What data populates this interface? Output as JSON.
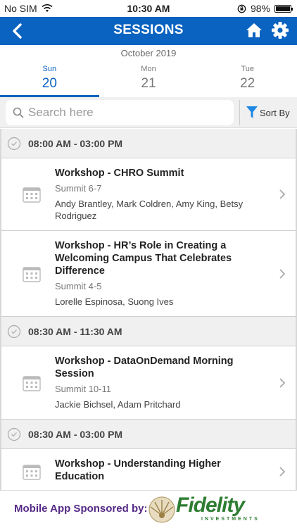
{
  "status_bar": {
    "carrier": "No SIM",
    "time": "10:30 AM",
    "battery": "98%",
    "battery_level": 0.98
  },
  "nav": {
    "title": "SESSIONS",
    "icons": [
      "back-arrow-icon",
      "home-icon",
      "gear-icon"
    ]
  },
  "calendar": {
    "month": "October 2019",
    "days": [
      {
        "name": "Sun",
        "number": "20",
        "selected": true
      },
      {
        "name": "Mon",
        "number": "21",
        "selected": false
      },
      {
        "name": "Tue",
        "number": "22",
        "selected": false
      }
    ]
  },
  "search": {
    "placeholder": "Search here",
    "value": "",
    "sort_label": "Sort By"
  },
  "groups": [
    {
      "time": "08:00 AM - 03:00 PM",
      "sessions": [
        {
          "title": "Workshop - CHRO Summit",
          "room": "Summit 6-7",
          "speakers": "Andy Brantley, Mark Coldren, Amy King, Betsy Rodriguez"
        },
        {
          "title": "Workshop - HR’s Role in Creating a Welcoming Campus That Celebrates Difference",
          "room": "Summit 4-5",
          "speakers": "Lorelle Espinosa, Suong Ives"
        }
      ]
    },
    {
      "time": "08:30 AM - 11:30 AM",
      "sessions": [
        {
          "title": "Workshop - DataOnDemand Morning Session",
          "room": "Summit 10-11",
          "speakers": "Jackie Bichsel, Adam Pritchard"
        }
      ]
    },
    {
      "time": "08:30 AM - 03:00 PM",
      "sessions": [
        {
          "title": "Workshop - Understanding Higher Education",
          "room": "",
          "speakers": ""
        }
      ]
    }
  ],
  "sponsor": {
    "label": "Mobile App Sponsored by:",
    "brand": "Fidelity",
    "brand_sub": "INVESTMENTS"
  },
  "colors": {
    "primary": "#0a63c0",
    "sponsor_label": "#552a86",
    "brand_green": "#2e7d32"
  }
}
